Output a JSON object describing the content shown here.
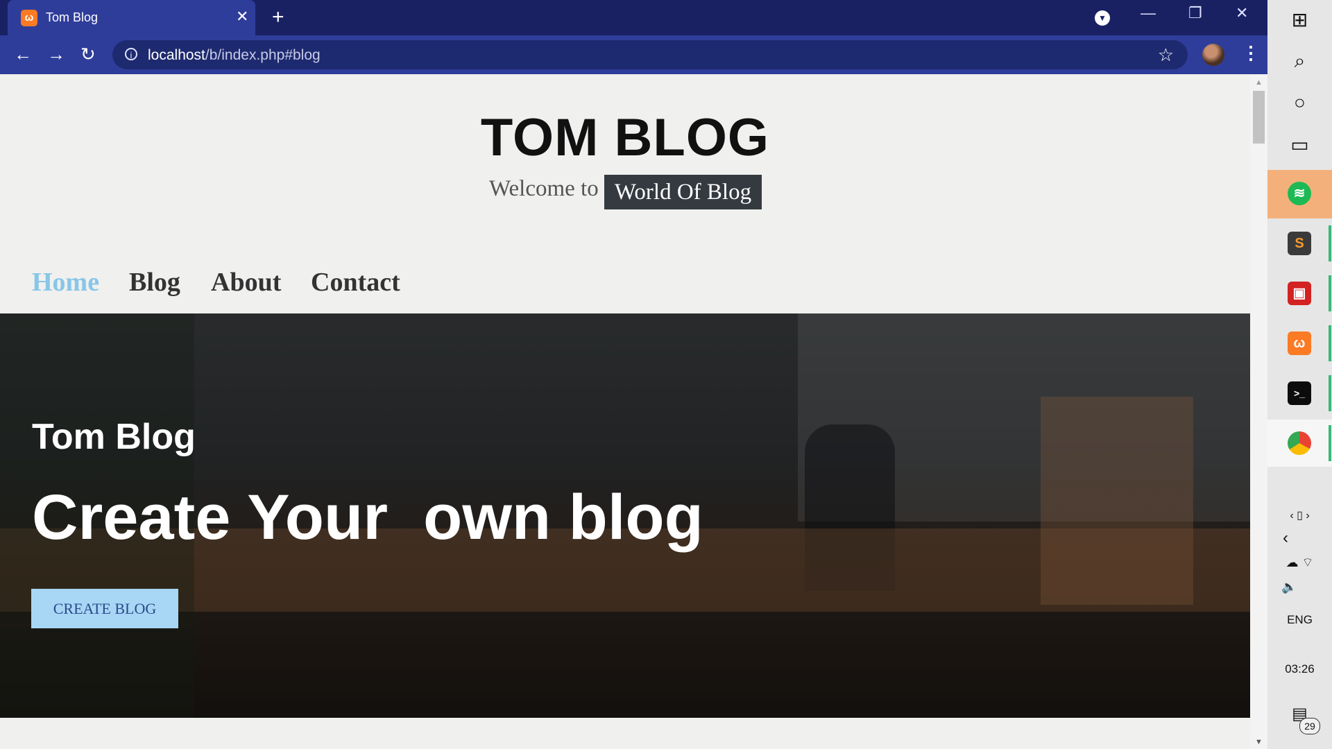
{
  "browser": {
    "tab_title": "Tom Blog",
    "tab_close": "✕",
    "new_tab": "+",
    "url_host": "localhost",
    "url_path": "/b/index.php#blog",
    "icons": [
      "xampp-favicon",
      "back-arrow-icon",
      "forward-arrow-icon",
      "reload-icon",
      "info-icon",
      "star-icon",
      "avatar",
      "menu-kebab-icon",
      "minimize-icon",
      "restore-icon",
      "close-icon"
    ]
  },
  "site": {
    "title": "TOM BLOG",
    "tagline_prefix": "Welcome to",
    "tagline_highlight": "World Of Blog",
    "nav": [
      "Home",
      "Blog",
      "About",
      "Contact"
    ],
    "nav_active": "Home",
    "hero_kicker": "Tom Blog",
    "hero_headline": "Create Your  own blog",
    "cta_label": "CREATE BLOG",
    "colors": {
      "active_nav": "#87c6e8",
      "cta_bg": "#a8d6f5",
      "tag_pill": "#343a40",
      "chrome": "#2f3d9a"
    }
  },
  "taskbar": {
    "language": "ENG",
    "time": "03:26",
    "notifications": "29",
    "pinned": [
      "spotify",
      "sublime-text",
      "bulldog-app",
      "xampp",
      "terminal",
      "chrome"
    ]
  }
}
